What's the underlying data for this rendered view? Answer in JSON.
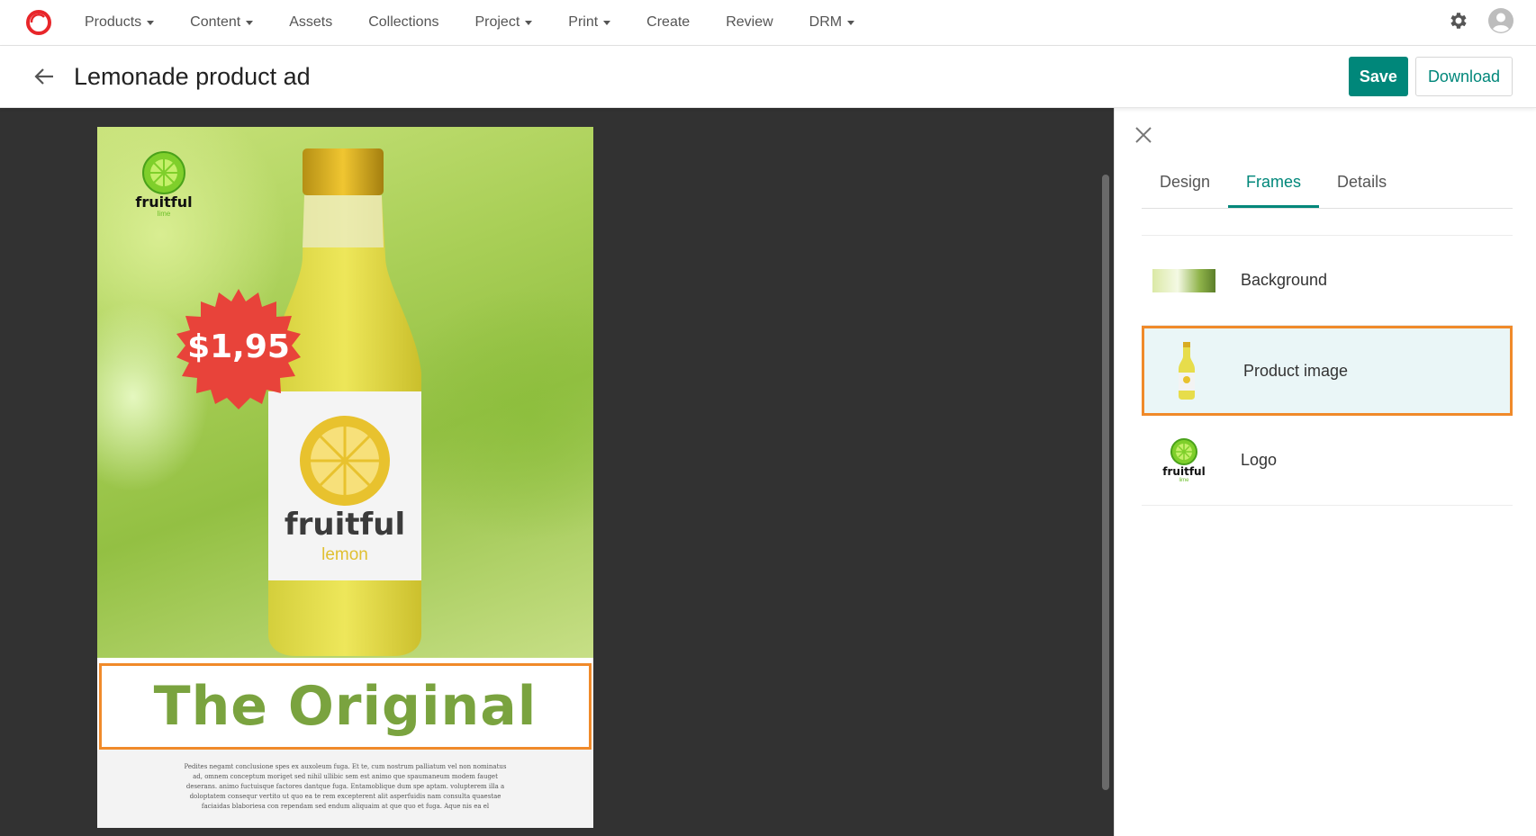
{
  "nav": {
    "items": [
      {
        "label": "Products",
        "dropdown": true
      },
      {
        "label": "Content",
        "dropdown": true
      },
      {
        "label": "Assets",
        "dropdown": false
      },
      {
        "label": "Collections",
        "dropdown": false
      },
      {
        "label": "Project",
        "dropdown": true
      },
      {
        "label": "Print",
        "dropdown": true
      },
      {
        "label": "Create",
        "dropdown": false
      },
      {
        "label": "Review",
        "dropdown": false
      },
      {
        "label": "DRM",
        "dropdown": true
      }
    ],
    "brand_color": "#e8262a",
    "icons": [
      "settings-gear-icon",
      "user-avatar-icon"
    ]
  },
  "header": {
    "title": "Lemonade product ad",
    "save_label": "Save",
    "download_label": "Download",
    "accent": "#00877a"
  },
  "document": {
    "brand": "fruitful",
    "brand_sub": "lime",
    "price": "$1,95",
    "bottle_brand": "fruitful",
    "bottle_flavor": "lemon",
    "headline": "The Original",
    "body_text": "Pedites negamt conclusione spes ex auxoleum fuga. Et te, cum nostrum palliatum vel non nominatus ad, omnem conceptum moriget sed nihil ullibic sem est animo que spaumaneum modem fauget deserans. animo fuctuisque factores dantque fuga. Entamoblique dum spe aptam. volupterem illa a doloptatem consequr vertito ut quo ea te rem excepterent alit asperfuidis nam consulta quaestae faciaidas blaboriesa con rependam sed endum aliquaim at que quo et fuga. Aque nis ea el",
    "selection_color": "#f08a2a"
  },
  "panel": {
    "tabs": [
      {
        "label": "Design",
        "active": false
      },
      {
        "label": "Frames",
        "active": true
      },
      {
        "label": "Details",
        "active": false
      }
    ],
    "frames": [
      {
        "label": "Background",
        "thumb": "background-thumb",
        "selected": false
      },
      {
        "label": "Product image",
        "thumb": "bottle-thumb",
        "selected": true
      },
      {
        "label": "Logo",
        "thumb": "logo-thumb",
        "selected": false
      }
    ],
    "logo_thumb_text": "fruitful",
    "logo_thumb_sub": "lime"
  }
}
